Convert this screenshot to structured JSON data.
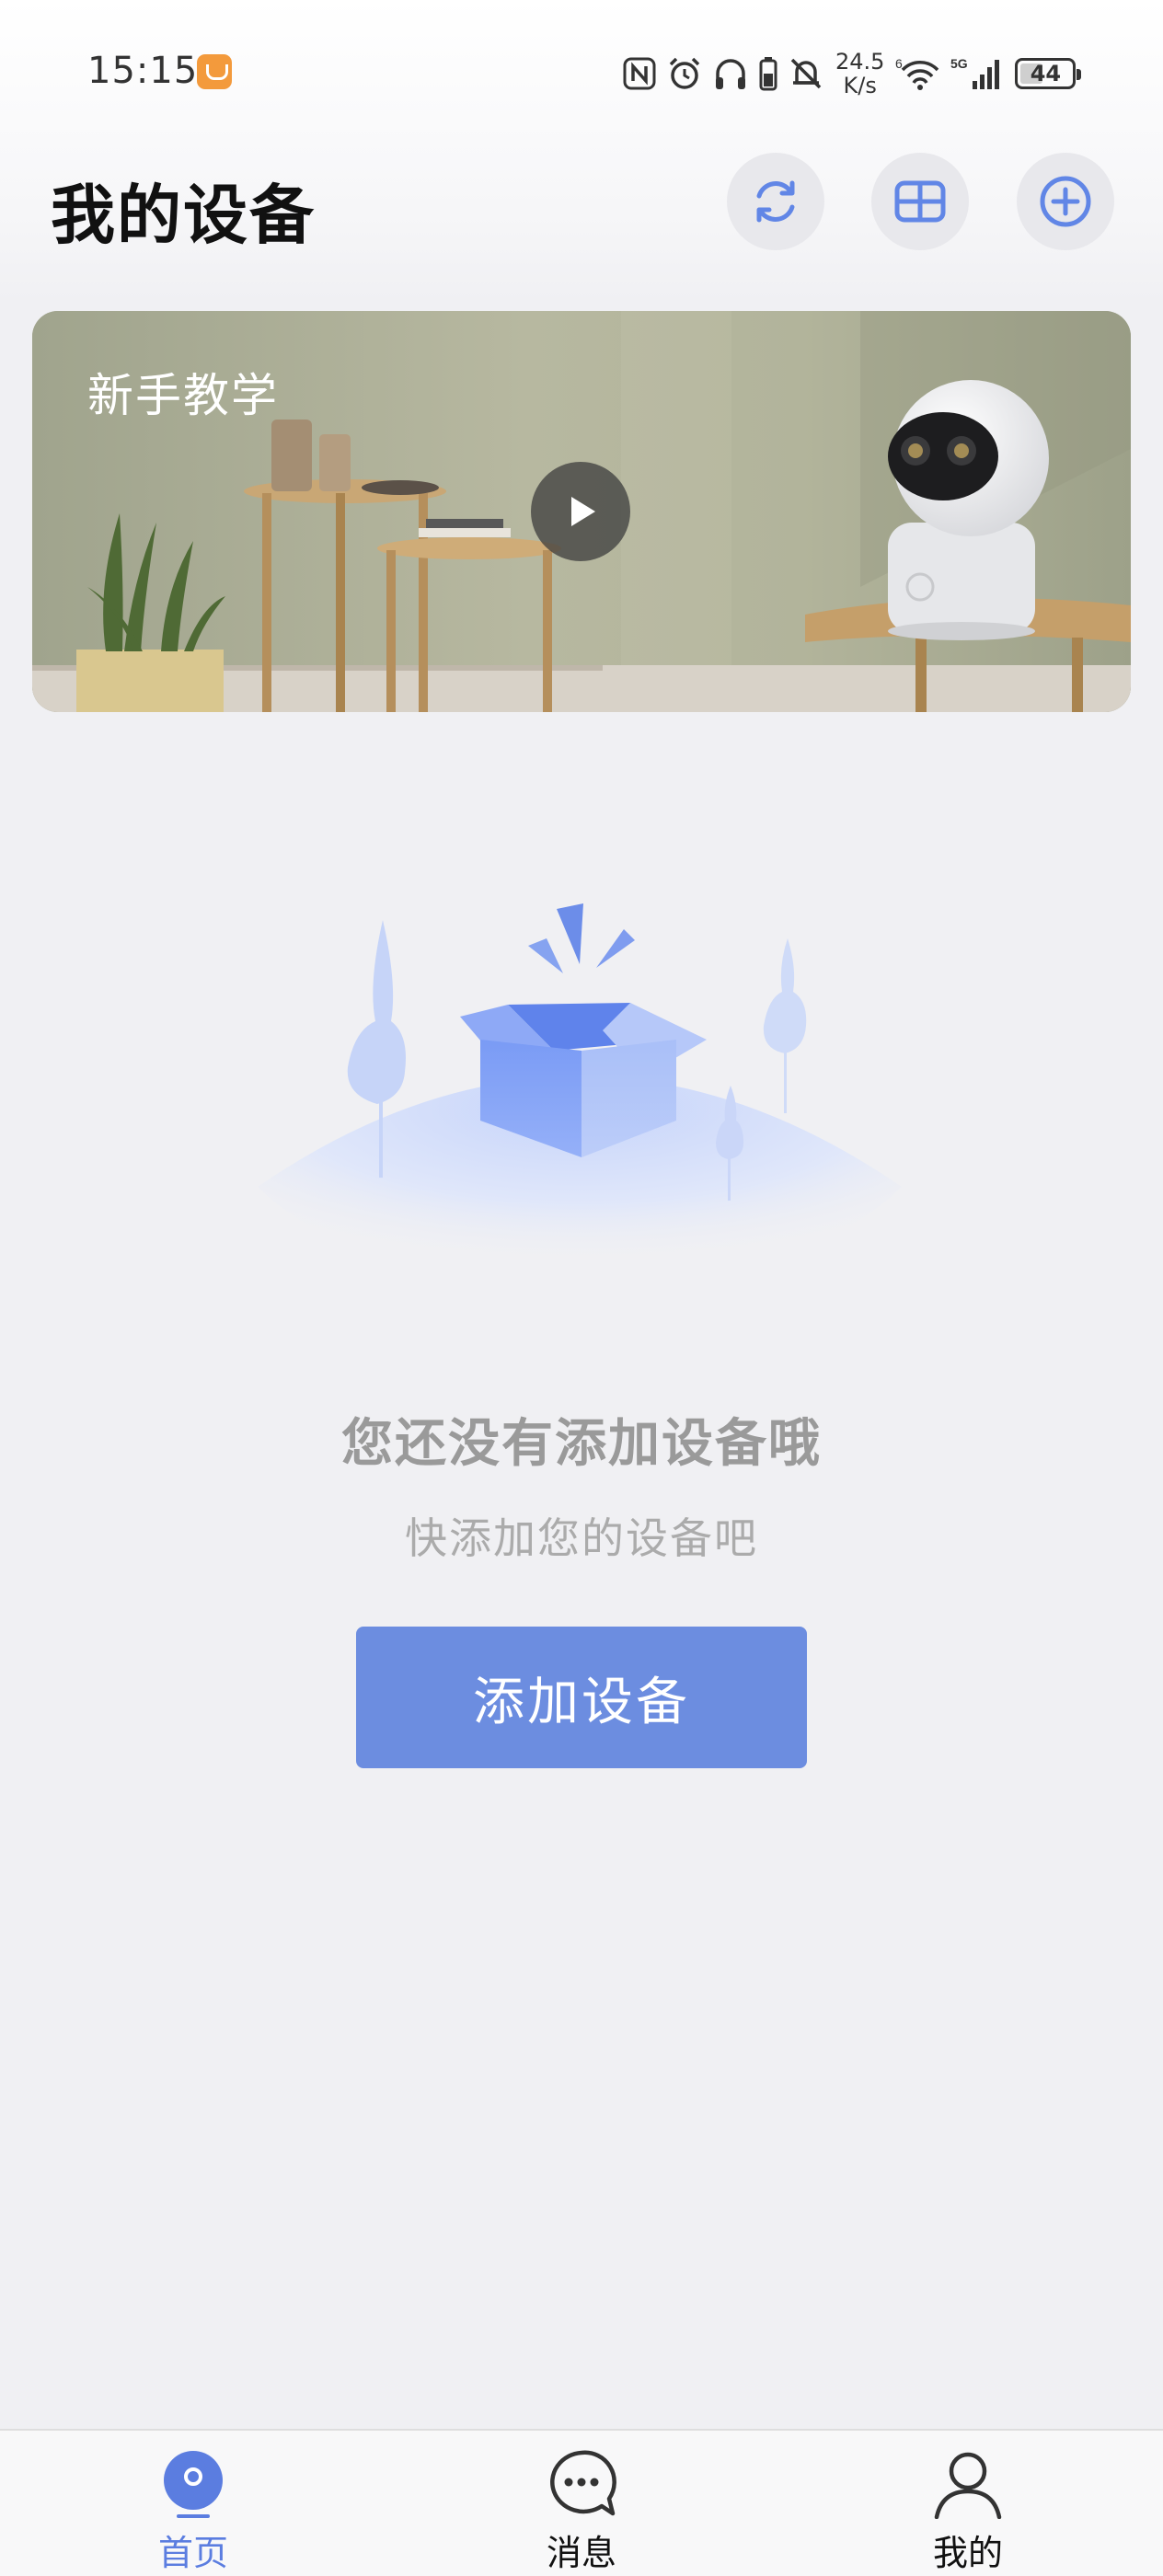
{
  "status_bar": {
    "time": "15:15",
    "net_speed_value": "24.5",
    "net_speed_unit": "K/s",
    "signal_5g": "5G",
    "wifi_6": "6",
    "battery": "44"
  },
  "header": {
    "title": "我的设备",
    "refresh_icon": "refresh-icon",
    "grid_icon": "grid-view-icon",
    "add_icon": "add-circle-icon"
  },
  "banner": {
    "title": "新手教学",
    "play_icon": "play-icon"
  },
  "empty_state": {
    "title": "您还没有添加设备哦",
    "subtitle": "快添加您的设备吧",
    "button_label": "添加设备"
  },
  "bottom_nav": {
    "items": [
      {
        "label": "首页",
        "icon": "home-camera-icon",
        "active": true
      },
      {
        "label": "消息",
        "icon": "message-bubble-icon",
        "active": false
      },
      {
        "label": "我的",
        "icon": "user-icon",
        "active": false
      }
    ]
  },
  "colors": {
    "accent": "#6c8de0",
    "nav_active": "#5b7de0",
    "background": "#f0f0f3"
  }
}
